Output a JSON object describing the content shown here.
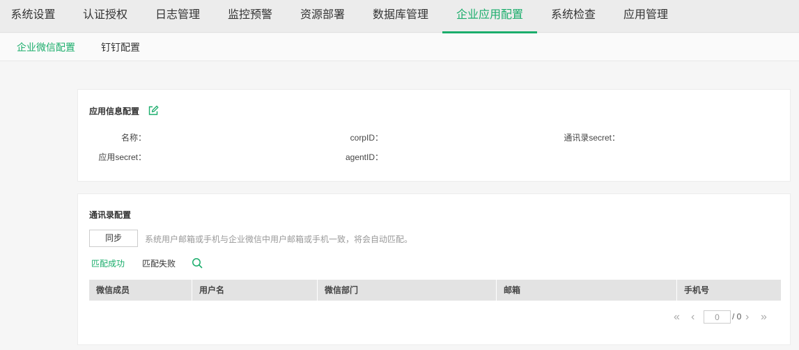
{
  "topnav": {
    "tabs": [
      {
        "label": "系统设置"
      },
      {
        "label": "认证授权"
      },
      {
        "label": "日志管理"
      },
      {
        "label": "监控预警"
      },
      {
        "label": "资源部署"
      },
      {
        "label": "数据库管理"
      },
      {
        "label": "企业应用配置",
        "active": true
      },
      {
        "label": "系统检查"
      },
      {
        "label": "应用管理"
      }
    ]
  },
  "subnav": {
    "tabs": [
      {
        "label": "企业微信配置",
        "active": true
      },
      {
        "label": "钉钉配置"
      }
    ]
  },
  "app_config": {
    "title": "应用信息配置",
    "fields": {
      "name": "名称：",
      "corp_id": "corpID：",
      "contacts_secret": "通讯录secret：",
      "app_secret": "应用secret：",
      "agent_id": "agentID："
    }
  },
  "contacts_config": {
    "title": "通讯录配置",
    "sync_label": "同步",
    "hint": "系统用户邮箱或手机与企业微信中用户邮箱或手机一致，将会自动匹配。",
    "filters": {
      "matched": "匹配成功",
      "unmatched": "匹配失败"
    },
    "columns": [
      "微信成员",
      "用户名",
      "微信部门",
      "邮箱",
      "手机号"
    ],
    "rows": []
  },
  "pagination": {
    "current_page": "0",
    "total": "/ 0",
    "first": "«",
    "prev": "‹",
    "next": "›",
    "last": "»"
  },
  "colors": {
    "accent": "#1aad6b"
  }
}
